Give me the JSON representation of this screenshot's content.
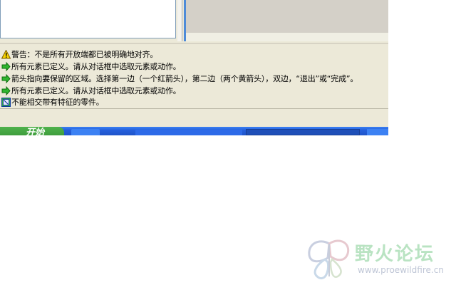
{
  "messages": [
    {
      "icon": "warning-triangle-icon",
      "text": "警告：不是所有开放端都已被明确地对齐。"
    },
    {
      "icon": "green-arrow-icon",
      "text": "所有元素已定义。请从对话框中选取元素或动作。"
    },
    {
      "icon": "green-arrow-icon",
      "text": "箭头指向要保留的区域。选择第一边（一个红箭头），第二边（两个黄箭头），双边，“退出”或“完成”。"
    },
    {
      "icon": "green-arrow-icon",
      "text": "所有元素已定义。请从对话框中选取元素或动作。"
    },
    {
      "icon": "error-square-icon",
      "text": "不能相交带有特征的零件。"
    }
  ],
  "taskbar": {
    "start_label": "开始"
  },
  "watermark": {
    "name": "野火论坛",
    "url": "www.proewildfire.cn"
  },
  "colors": {
    "window_bg": "#ece9d8",
    "taskbar_blue": "#245edb",
    "start_green": "#3c9a3a",
    "watermark_green": "#b9e3c2"
  }
}
